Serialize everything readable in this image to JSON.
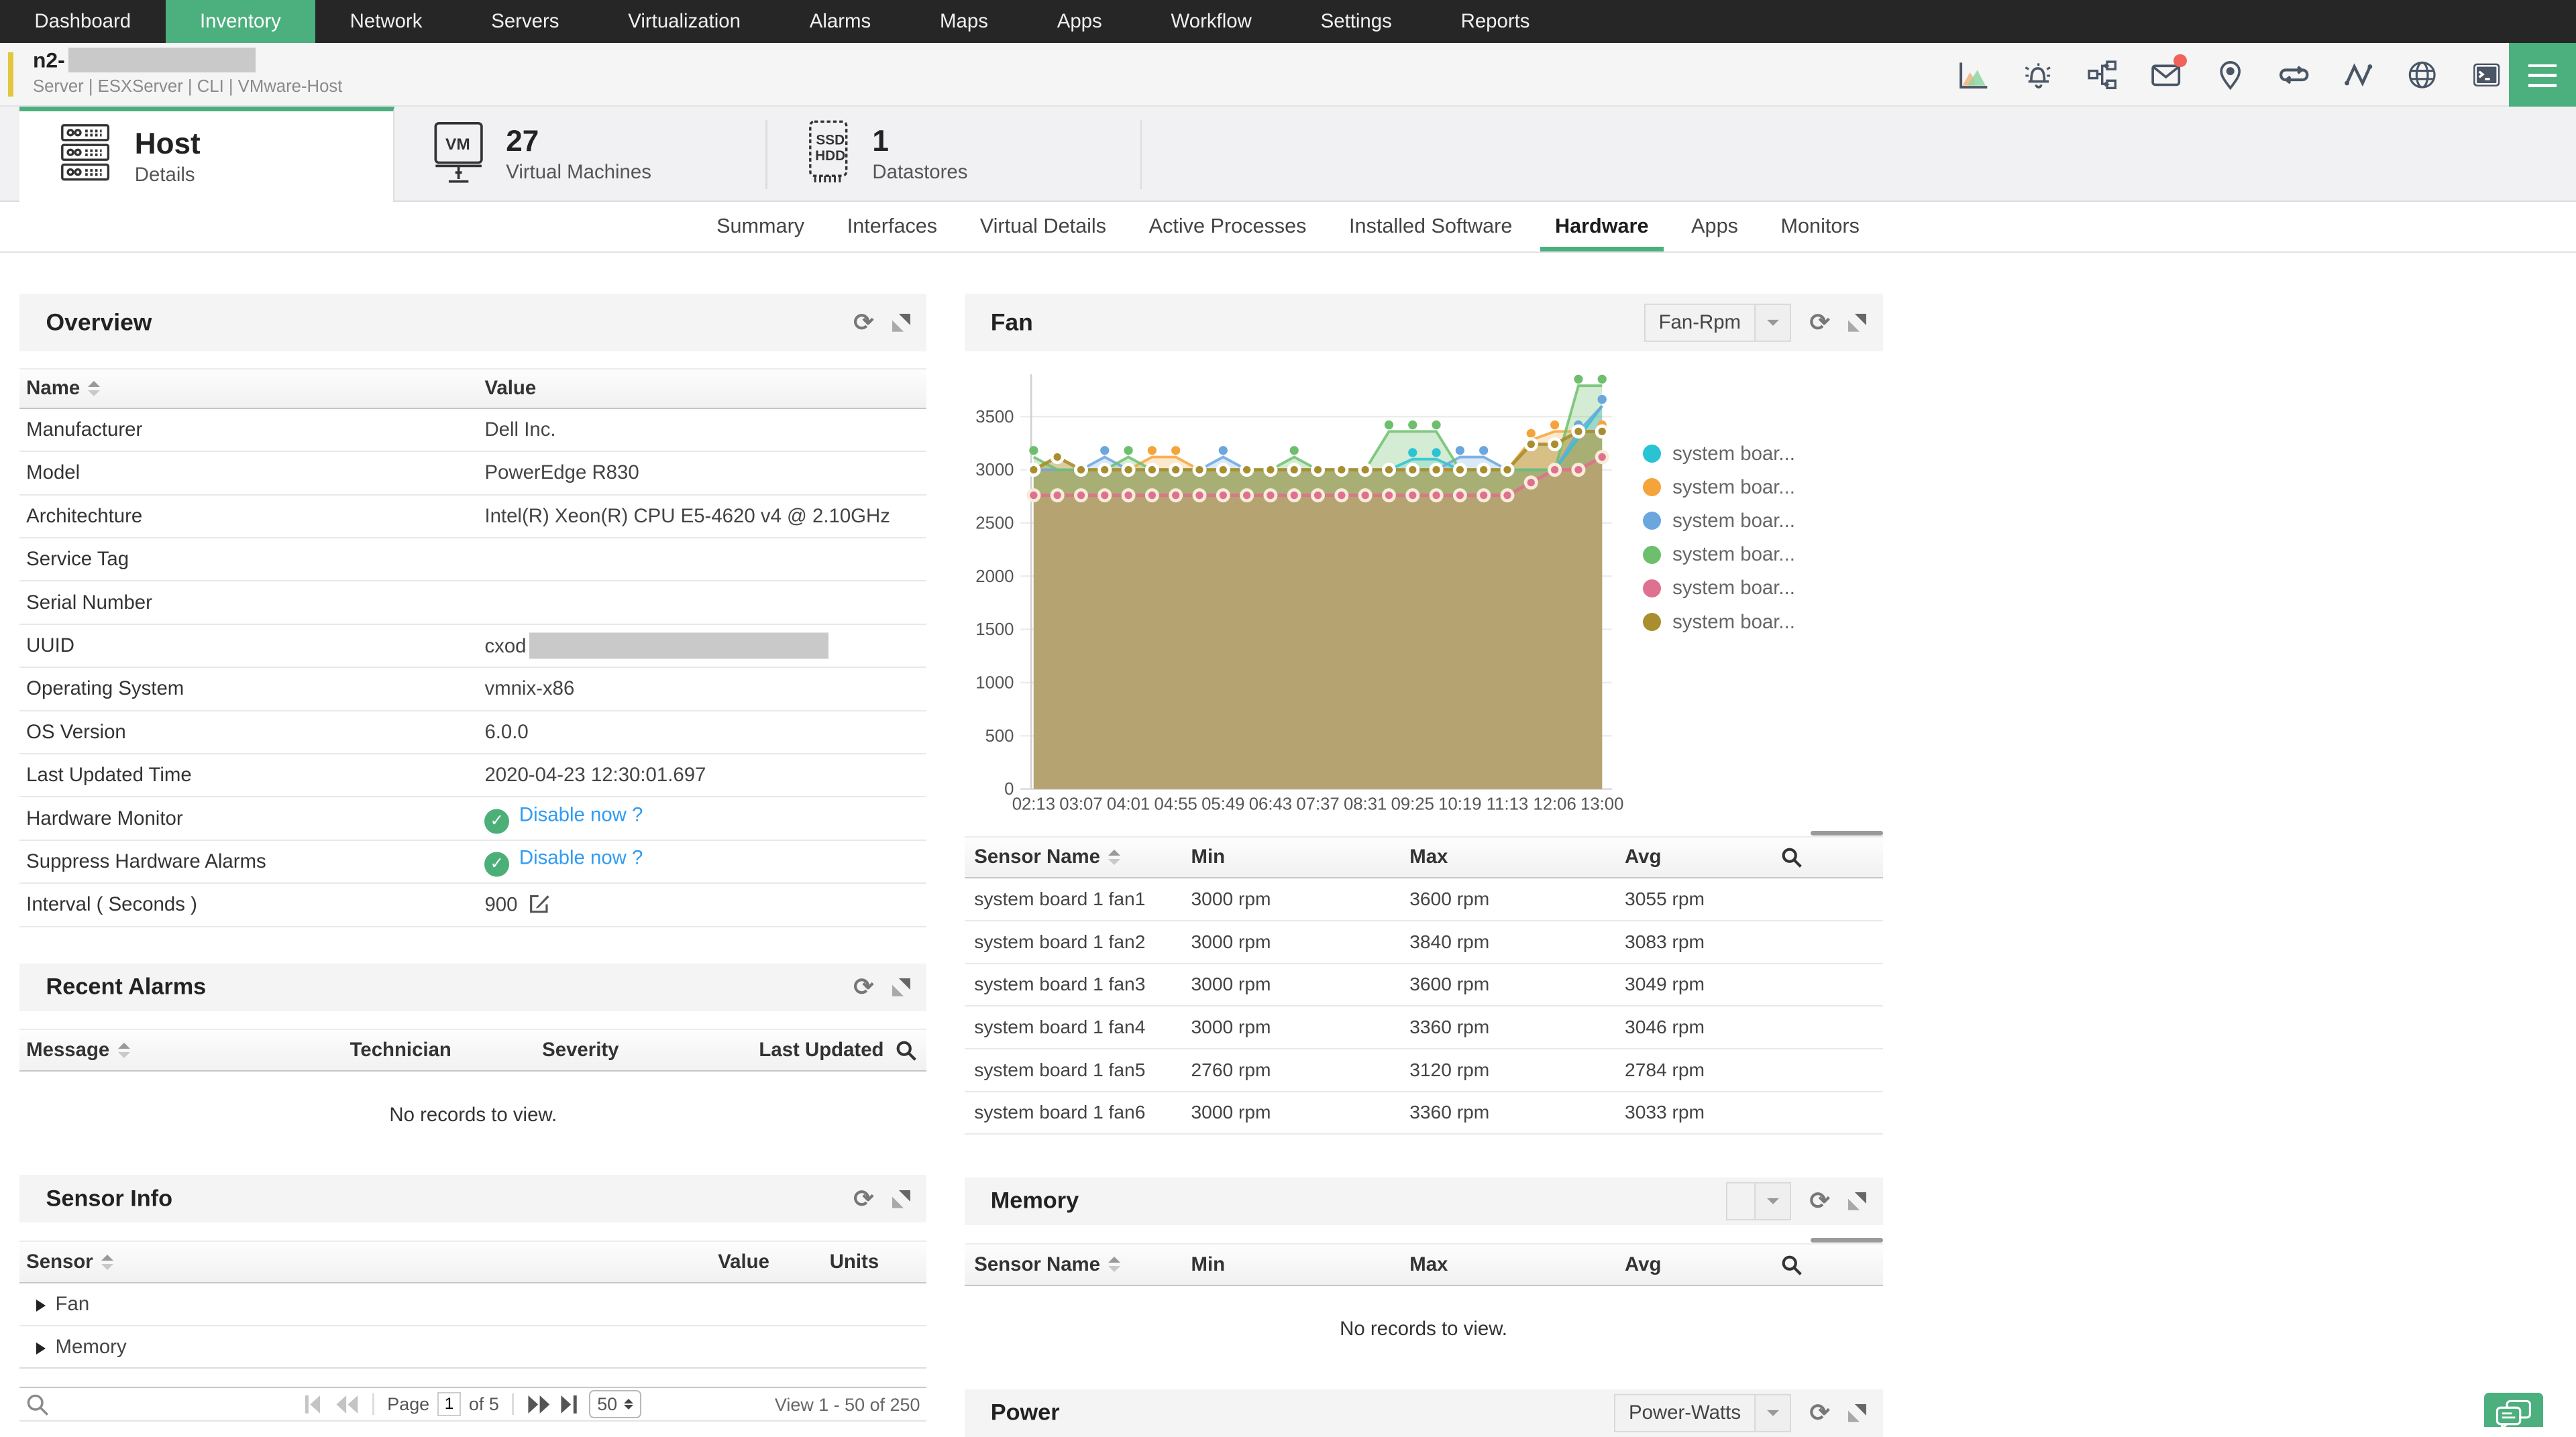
{
  "nav": {
    "items": [
      {
        "label": "Dashboard",
        "active": false
      },
      {
        "label": "Inventory",
        "active": true
      },
      {
        "label": "Network",
        "active": false
      },
      {
        "label": "Servers",
        "active": false
      },
      {
        "label": "Virtualization",
        "active": false
      },
      {
        "label": "Alarms",
        "active": false
      },
      {
        "label": "Maps",
        "active": false
      },
      {
        "label": "Apps",
        "active": false
      },
      {
        "label": "Workflow",
        "active": false
      },
      {
        "label": "Settings",
        "active": false
      },
      {
        "label": "Reports",
        "active": false
      }
    ]
  },
  "header": {
    "title_prefix": "n2-",
    "subtitle": "Server | ESXServer  | CLI  | VMware-Host",
    "icons": [
      "area-chart-icon",
      "alarm-bell-icon",
      "workflow-icon",
      "mail-icon",
      "location-pin-icon",
      "sync-loop-icon",
      "pulse-icon",
      "globe-icon",
      "terminal-icon",
      "menu-button"
    ],
    "accent_color": "#E3C63C",
    "brand_green": "#4CAF7E"
  },
  "tabs": [
    {
      "title": "Host",
      "subtitle": "Details",
      "icon": "server-rack-icon",
      "active": true
    },
    {
      "title": "27",
      "subtitle": "Virtual Machines",
      "icon": "vm-monitor-icon",
      "active": false
    },
    {
      "title": "1",
      "subtitle": "Datastores",
      "icon": "ssd-hdd-icon",
      "active": false
    }
  ],
  "subtabs": {
    "items": [
      "Summary",
      "Interfaces",
      "Virtual Details",
      "Active Processes",
      "Installed Software",
      "Hardware",
      "Apps",
      "Monitors"
    ],
    "active": "Hardware"
  },
  "overview": {
    "title": "Overview",
    "columns": [
      "Name",
      "Value"
    ],
    "rows": [
      {
        "name": "Manufacturer",
        "value": "Dell Inc.",
        "kind": "plain"
      },
      {
        "name": "Model",
        "value": "PowerEdge R830",
        "kind": "plain"
      },
      {
        "name": "Architechture",
        "value": "Intel(R) Xeon(R) CPU E5-4620 v4 @ 2.10GHz",
        "kind": "plain"
      },
      {
        "name": "Service Tag",
        "value": "",
        "kind": "plain"
      },
      {
        "name": "Serial Number",
        "value": "",
        "kind": "plain"
      },
      {
        "name": "UUID",
        "value": "cxod",
        "kind": "redacted"
      },
      {
        "name": "Operating System",
        "value": "vmnix-x86",
        "kind": "plain"
      },
      {
        "name": "OS Version",
        "value": "6.0.0",
        "kind": "plain"
      },
      {
        "name": "Last Updated Time",
        "value": "2020-04-23 12:30:01.697",
        "kind": "plain"
      },
      {
        "name": "Hardware Monitor",
        "value": "Disable now ?",
        "kind": "toggle"
      },
      {
        "name": "Suppress Hardware Alarms",
        "value": "Disable now ?",
        "kind": "toggle"
      },
      {
        "name": "Interval ( Seconds )",
        "value": "900",
        "kind": "editable"
      }
    ]
  },
  "recent_alarms": {
    "title": "Recent Alarms",
    "columns": [
      "Message",
      "Technician",
      "Severity",
      "Last Updated"
    ],
    "empty_text": "No records to view."
  },
  "sensor_info": {
    "title": "Sensor Info",
    "columns": [
      "Sensor",
      "Value",
      "Units"
    ],
    "groups": [
      "Fan",
      "Memory"
    ],
    "pagination": {
      "page_label": "Page",
      "page_value": "1",
      "of_label": "of 5",
      "page_size": "50",
      "view_text": "View 1 - 50 of 250"
    }
  },
  "fan": {
    "title": "Fan",
    "dropdown_value": "Fan-Rpm",
    "table": {
      "columns": [
        "Sensor Name",
        "Min",
        "Max",
        "Avg"
      ],
      "rows": [
        [
          "system board 1 fan1",
          "3000 rpm",
          "3600 rpm",
          "3055 rpm"
        ],
        [
          "system board 1 fan2",
          "3000 rpm",
          "3840 rpm",
          "3083 rpm"
        ],
        [
          "system board 1 fan3",
          "3000 rpm",
          "3600 rpm",
          "3049 rpm"
        ],
        [
          "system board 1 fan4",
          "3000 rpm",
          "3360 rpm",
          "3046 rpm"
        ],
        [
          "system board 1 fan5",
          "2760 rpm",
          "3120 rpm",
          "2784 rpm"
        ],
        [
          "system board 1 fan6",
          "3000 rpm",
          "3360 rpm",
          "3033 rpm"
        ]
      ]
    }
  },
  "memory": {
    "title": "Memory",
    "dropdown_value": "",
    "columns": [
      "Sensor Name",
      "Min",
      "Max",
      "Avg"
    ],
    "empty_text": "No records to view."
  },
  "power": {
    "title": "Power",
    "dropdown_value": "Power-Watts"
  },
  "chart_data": {
    "type": "area",
    "title": "Fan (Fan-Rpm)",
    "unit": "rpm",
    "ylim": [
      0,
      3800
    ],
    "y_ticks": [
      0,
      500,
      1000,
      1500,
      2000,
      2500,
      3000,
      3500
    ],
    "x_tick_labels": [
      "02:13",
      "03:07",
      "04:01",
      "04:55",
      "05:49",
      "06:43",
      "07:37",
      "08:31",
      "09:25",
      "10:19",
      "11:13",
      "12:06",
      "13:00"
    ],
    "points_per_tick": 2,
    "legend_position": "right",
    "grid": true,
    "series": [
      {
        "name": "system boar...",
        "full_name": "system board 1 fan1",
        "color": "#29C3D4",
        "values": [
          3000,
          3000,
          3000,
          3000,
          3000,
          3000,
          3000,
          3000,
          3000,
          3000,
          3000,
          3000,
          3000,
          3000,
          3000,
          3000,
          3100,
          3100,
          3000,
          3000,
          3000,
          3000,
          3000,
          3300,
          3600
        ]
      },
      {
        "name": "system boar...",
        "full_name": "system board 1 fan2",
        "color": "#F5A43C",
        "values": [
          3000,
          3000,
          3000,
          3000,
          3000,
          3120,
          3120,
          3000,
          3000,
          3000,
          3000,
          3000,
          3000,
          3000,
          3000,
          3000,
          3000,
          3000,
          3000,
          3000,
          3000,
          3280,
          3360,
          3360,
          3360
        ]
      },
      {
        "name": "system boar...",
        "full_name": "system board 1 fan3",
        "color": "#6BA6DE",
        "values": [
          3000,
          3000,
          3000,
          3120,
          3000,
          3000,
          3000,
          3000,
          3120,
          3000,
          3000,
          3000,
          3000,
          3000,
          3000,
          3000,
          3000,
          3000,
          3120,
          3120,
          3000,
          3000,
          3000,
          3360,
          3600
        ]
      },
      {
        "name": "system boar...",
        "full_name": "system board 1 fan4",
        "color": "#6DBF6D",
        "values": [
          3120,
          3000,
          3000,
          3000,
          3120,
          3000,
          3000,
          3000,
          3000,
          3000,
          3000,
          3120,
          3000,
          3000,
          3000,
          3360,
          3360,
          3360,
          3000,
          3000,
          3000,
          3000,
          3000,
          3790,
          3790
        ]
      },
      {
        "name": "system boar...",
        "full_name": "system board 1 fan5",
        "color": "#E0708F",
        "values": [
          2760,
          2760,
          2760,
          2760,
          2760,
          2760,
          2760,
          2760,
          2760,
          2760,
          2760,
          2760,
          2760,
          2760,
          2760,
          2760,
          2760,
          2760,
          2760,
          2760,
          2760,
          2880,
          3000,
          3000,
          3120
        ]
      },
      {
        "name": "system boar...",
        "full_name": "system board 1 fan6",
        "color": "#A98E2F",
        "values": [
          3000,
          3120,
          3000,
          3000,
          3000,
          3000,
          3000,
          3000,
          3000,
          3000,
          3000,
          3000,
          3000,
          3000,
          3000,
          3000,
          3000,
          3000,
          3000,
          3000,
          3000,
          3240,
          3240,
          3360,
          3360
        ]
      }
    ]
  }
}
